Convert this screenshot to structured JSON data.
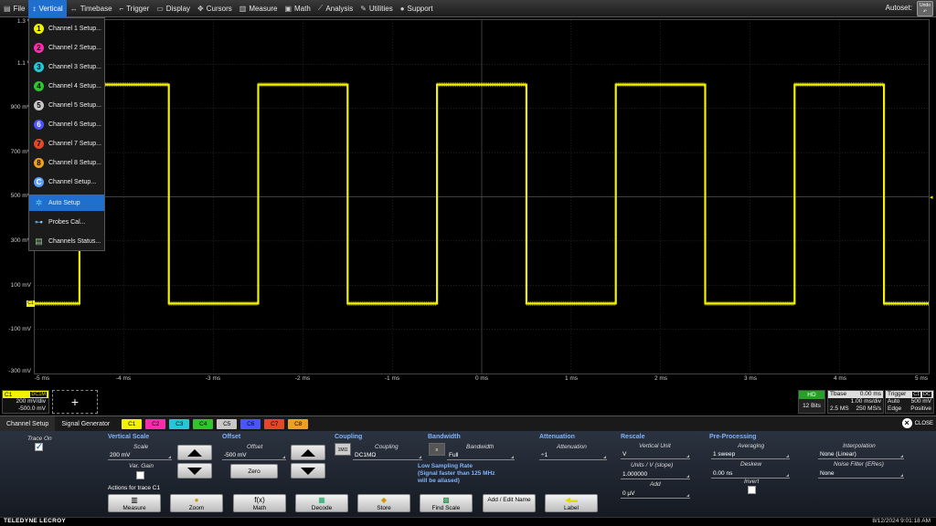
{
  "menubar": {
    "items": [
      {
        "label": "File",
        "icon": "file-icon"
      },
      {
        "label": "Vertical",
        "icon": "vertical-icon",
        "active": true
      },
      {
        "label": "Timebase",
        "icon": "timebase-icon"
      },
      {
        "label": "Trigger",
        "icon": "trigger-icon"
      },
      {
        "label": "Display",
        "icon": "display-icon"
      },
      {
        "label": "Cursors",
        "icon": "cursors-icon"
      },
      {
        "label": "Measure",
        "icon": "measure-icon"
      },
      {
        "label": "Math",
        "icon": "math-icon"
      },
      {
        "label": "Analysis",
        "icon": "analysis-icon"
      },
      {
        "label": "Utilities",
        "icon": "utilities-icon"
      },
      {
        "label": "Support",
        "icon": "support-icon"
      }
    ],
    "autoset_label": "Autoset:",
    "undo_label": "Undo"
  },
  "dropdown": {
    "items": [
      {
        "label": "Channel 1 Setup...",
        "num": "1",
        "color": "#f2f200"
      },
      {
        "label": "Channel 2 Setup...",
        "num": "2",
        "color": "#ff2bac"
      },
      {
        "label": "Channel 3 Setup...",
        "num": "3",
        "color": "#22c8d8"
      },
      {
        "label": "Channel 4 Setup...",
        "num": "4",
        "color": "#2fc52f"
      },
      {
        "label": "Channel 5 Setup...",
        "num": "5",
        "color": "#c8c8c8"
      },
      {
        "label": "Channel 6 Setup...",
        "num": "6",
        "color": "#4a55ff"
      },
      {
        "label": "Channel 7 Setup...",
        "num": "7",
        "color": "#e6452a"
      },
      {
        "label": "Channel 8 Setup...",
        "num": "8",
        "color": "#f0a020"
      },
      {
        "label": "Channel Setup...",
        "num": "C",
        "color": "#5aa0ff"
      },
      {
        "label": "Auto Setup",
        "icon": "auto-setup-icon",
        "selected": true
      },
      {
        "label": "Probes Cal...",
        "icon": "probe-icon"
      },
      {
        "label": "Channels Status...",
        "icon": "status-icon"
      }
    ]
  },
  "waveform": {
    "color": "#f2f200",
    "ylabels": [
      "1.3 V",
      "1.1 V",
      "900 mV",
      "700 mV",
      "500 mV",
      "300 mV",
      "100 mV",
      "-100 mV",
      "-300 mV"
    ],
    "xlabels": [
      "-5 ms",
      "-4 ms",
      "-3 ms",
      "-2 ms",
      "-1 ms",
      "0 ms",
      "1 ms",
      "2 ms",
      "3 ms",
      "4 ms",
      "5 ms"
    ],
    "channel_marker": "C1"
  },
  "channel_box": {
    "name": "C1",
    "coupling": "DC1M",
    "scale": "200 mV/div",
    "offset": "-500.0 mV",
    "add_label": "+"
  },
  "timebase_box": {
    "hd_label": "HD",
    "bits": "12 Bits",
    "tbase_label": "Tbase",
    "tbase_value": "0.00 ms",
    "div_value": "1.00 ms/div",
    "samples": "2.5 MS",
    "rate": "250 MS/s"
  },
  "trigger_box": {
    "label": "Trigger",
    "ch1": "C1",
    "ch2": "DC",
    "mode": "Auto",
    "level": "500 mV",
    "type": "Edge",
    "slope": "Positive"
  },
  "tabs": {
    "items": [
      "Channel Setup",
      "Signal Generator"
    ],
    "channels": [
      {
        "label": "C1",
        "color": "#f2f200"
      },
      {
        "label": "C2",
        "color": "#ff2bac"
      },
      {
        "label": "C3",
        "color": "#22c8d8"
      },
      {
        "label": "C4",
        "color": "#2fc52f"
      },
      {
        "label": "C5",
        "color": "#c8c8c8"
      },
      {
        "label": "C6",
        "color": "#4a55ff"
      },
      {
        "label": "C7",
        "color": "#e6452a"
      },
      {
        "label": "C8",
        "color": "#f0a020"
      }
    ],
    "close_label": "CLOSE"
  },
  "panel": {
    "trace_on_label": "Trace On",
    "vertical_scale_header": "Vertical Scale",
    "scale_label": "Scale",
    "scale_value": "200 mV",
    "var_gain_label": "Var. Gain",
    "offset_header": "Offset",
    "offset_label": "Offset",
    "offset_value": "-500 mV",
    "zero_label": "Zero",
    "coupling_header": "Coupling",
    "coupling_label": "Coupling",
    "coupling_value": "DC1MΩ",
    "coupling_icon_text": "1MΩ",
    "bandwidth_header": "Bandwidth",
    "bandwidth_label": "Bandwidth",
    "bandwidth_value": "Full",
    "low_sampling_note_1": "Low Sampling Rate",
    "low_sampling_note_2": "(Signal faster than 125 MHz",
    "low_sampling_note_3": "will be aliased)",
    "attenuation_header": "Attenuation",
    "attenuation_label": "Attenuation",
    "attenuation_value": "÷1",
    "rescale_header": "Rescale",
    "vertical_unit_label": "Vertical Unit",
    "vertical_unit_value": "V",
    "units_slope_label": "Units / V (slope)",
    "units_slope_value": "1.000000",
    "add_label": "Add",
    "add_value": "0 µV",
    "preproc_header": "Pre-Processing",
    "averaging_label": "Averaging",
    "averaging_value": "1 sweep",
    "deskew_label": "Deskew",
    "deskew_value": "0.00 ns",
    "invert_label": "Invert",
    "interpolation_label": "Interpolation",
    "interpolation_value": "None (Linear)",
    "noise_filter_label": "Noise Filter (ERes)",
    "noise_filter_value": "None",
    "actions_label": "Actions for trace C1",
    "actions": [
      {
        "label": "Measure",
        "icon": "measure-icon"
      },
      {
        "label": "Zoom",
        "icon": "zoom-icon"
      },
      {
        "label": "Math",
        "icon": "math-fx-icon"
      },
      {
        "label": "Decode",
        "icon": "decode-icon"
      },
      {
        "label": "Store",
        "icon": "store-icon"
      },
      {
        "label": "Find Scale",
        "icon": "find-scale-icon"
      },
      {
        "label": "Add / Edit Name",
        "icon": ""
      },
      {
        "label": "Label",
        "icon": "label-icon"
      }
    ]
  },
  "footer": {
    "brand": "TELEDYNE LECROY",
    "datetime": "8/12/2024 9:01:18 AM"
  }
}
